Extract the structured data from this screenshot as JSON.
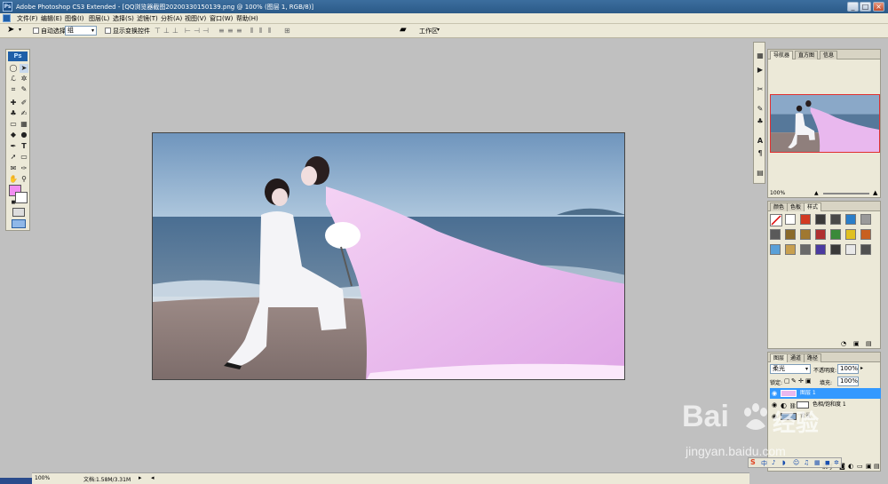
{
  "window": {
    "title": "Adobe Photoshop CS3 Extended - [QQ浏览器截图20200330150139.png @ 100% (图层 1, RGB/8)]",
    "app_badge": "Ps",
    "min": "_",
    "max": "□",
    "close": "×"
  },
  "menu": [
    "文件(F)",
    "编辑(E)",
    "图像(I)",
    "图层(L)",
    "选择(S)",
    "滤镜(T)",
    "分析(A)",
    "视图(V)",
    "窗口(W)",
    "帮助(H)"
  ],
  "options": {
    "auto_select_label": "自动选择:",
    "auto_select_value": "组",
    "show_transform_label": "显示变换控件",
    "workspace_label": "工作区"
  },
  "toolbox": {
    "logo": "Ps"
  },
  "status": {
    "zoom": "100%",
    "doc": "文档:1.58M/3.31M"
  },
  "navigator": {
    "tabs": [
      "导航器",
      "直方图",
      "信息"
    ],
    "zoom": "100%"
  },
  "styles_panel": {
    "tabs": [
      "颜色",
      "色板",
      "样式"
    ],
    "swatches": [
      "#ffffff",
      "#d23a22",
      "#3a3a3a",
      "#4a4a4a",
      "#2a7ec8",
      "#9a9a9a",
      "#5a5a5a",
      "#8a6a2a",
      "#a07830",
      "#b03030",
      "#3a8a3a",
      "#e0c020",
      "#c86020",
      "#5aa0d8",
      "#c8a050",
      "#6a6a6a",
      "#4a3aa0",
      "#3a3a3a",
      "#e8e8e8",
      "#505050"
    ]
  },
  "layers": {
    "tabs": [
      "图层",
      "通道",
      "路径"
    ],
    "blend_mode": "柔光",
    "opacity_label": "不透明度:",
    "opacity_value": "100%",
    "lock_label": "锁定:",
    "fill_label": "填充:",
    "fill_value": "100%",
    "items": [
      {
        "name": "图层 1",
        "selected": true
      },
      {
        "name": "色相/饱和度 1",
        "selected": false
      },
      {
        "name": "背景",
        "selected": false
      }
    ]
  },
  "watermark": {
    "brand": "Bai",
    "brand2": "经验",
    "url": "jingyan.baidu.com"
  },
  "colors": {
    "accent_blue": "#3399ff",
    "foreground": "#f28ef2",
    "background": "#ffffff"
  }
}
